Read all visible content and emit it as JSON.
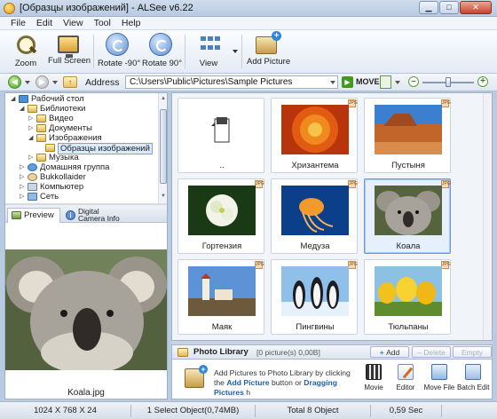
{
  "window": {
    "title": "[Образцы изображений] - ALSee v6.22",
    "min_glyph": "▁",
    "max_glyph": "□",
    "close_glyph": "✕"
  },
  "menu": [
    "File",
    "Edit",
    "View",
    "Tool",
    "Help"
  ],
  "toolbar": {
    "zoom": "Zoom",
    "full_screen": "Full Screen",
    "rotate_left": "Rotate -90°",
    "rotate_right": "Rotate 90°",
    "view": "View",
    "add_picture": "Add Picture"
  },
  "address": {
    "label": "Address",
    "path": "C:\\Users\\Public\\Pictures\\Sample Pictures",
    "move": "MOVE",
    "back_glyph": "◀",
    "forward_glyph": "▶",
    "up_glyph": "↑",
    "zoom_minus": "–",
    "zoom_plus": "+",
    "zoom_level": 0.5
  },
  "tree": [
    {
      "label": "Рабочий стол",
      "depth": 0,
      "toggle": "◢",
      "icon": "desktop"
    },
    {
      "label": "Библиотеки",
      "depth": 1,
      "toggle": "◢",
      "icon": "lib"
    },
    {
      "label": "Видео",
      "depth": 2,
      "toggle": "▷",
      "icon": "folder"
    },
    {
      "label": "Документы",
      "depth": 2,
      "toggle": "▷",
      "icon": "folder"
    },
    {
      "label": "Изображения",
      "depth": 2,
      "toggle": "◢",
      "icon": "folder"
    },
    {
      "label": "Образцы изображений",
      "depth": 3,
      "toggle": "",
      "icon": "folder",
      "selected": true
    },
    {
      "label": "Музыка",
      "depth": 2,
      "toggle": "▷",
      "icon": "folder"
    },
    {
      "label": "Домашняя группа",
      "depth": 1,
      "toggle": "▷",
      "icon": "group"
    },
    {
      "label": "Bukkollaider",
      "depth": 1,
      "toggle": "▷",
      "icon": "user"
    },
    {
      "label": "Компьютер",
      "depth": 1,
      "toggle": "▷",
      "icon": "pc"
    },
    {
      "label": "Сеть",
      "depth": 1,
      "toggle": "▷",
      "icon": "net"
    }
  ],
  "tabs": {
    "preview": "Preview",
    "info_line1": "Digital",
    "info_line2": "Camera Info",
    "info_glyph": "i"
  },
  "preview": {
    "caption": "Koala.jpg"
  },
  "thumbnails": [
    {
      "label": "..",
      "kind": "parent"
    },
    {
      "label": "Хризантема",
      "kind": "chrysanthemum"
    },
    {
      "label": "Пустыня",
      "kind": "desert"
    },
    {
      "label": "Гортензия",
      "kind": "hydrangea"
    },
    {
      "label": "Медуза",
      "kind": "jellyfish"
    },
    {
      "label": "Коала",
      "kind": "koala",
      "selected": true
    },
    {
      "label": "Маяк",
      "kind": "lighthouse"
    },
    {
      "label": "Пингвины",
      "kind": "penguins"
    },
    {
      "label": "Тюльпаны",
      "kind": "tulips"
    }
  ],
  "library": {
    "title": "Photo Library",
    "count": "[0 picture(s) 0,00B]",
    "add": "Add",
    "delete": "Delete",
    "empty": "Empty",
    "msg_part1": "Add Pictures to Photo Library by clicking the ",
    "msg_link1": "Add Picture",
    "msg_part2": " button or ",
    "msg_link2": "Dragging Pictures",
    "msg_part3": " h",
    "tools": [
      "Movie",
      "Editor",
      "Move File",
      "Batch Edit"
    ]
  },
  "status": {
    "dimensions": "1024 X 768 X 24",
    "selection": "1 Select Object(0,74MB)",
    "total": "Total 8 Object",
    "time": "0,59 Sec"
  }
}
